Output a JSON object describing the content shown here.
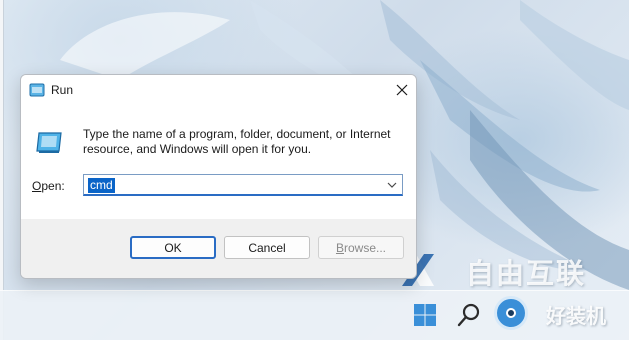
{
  "dialog": {
    "title": "Run",
    "close_symbol": "✕",
    "description": "Type the name of a program, folder, document, or Internet resource, and Windows will open it for you.",
    "open_label_prefix": "O",
    "open_label_rest": "pen:",
    "open_value": "cmd",
    "buttons": {
      "ok": "OK",
      "cancel": "Cancel",
      "browse_prefix": "B",
      "browse_rest": "rowse..."
    }
  },
  "watermark": {
    "main": "自由互联",
    "sub": "好装机"
  },
  "icons": {
    "title": "run-icon",
    "dialog": "run-icon",
    "combo_arrow": "chevron-down-icon",
    "taskbar": [
      "windows-logo-icon",
      "search-icon",
      "app-icon"
    ]
  },
  "colors": {
    "accent": "#2a6cc4",
    "selection": "#0a64c8"
  }
}
